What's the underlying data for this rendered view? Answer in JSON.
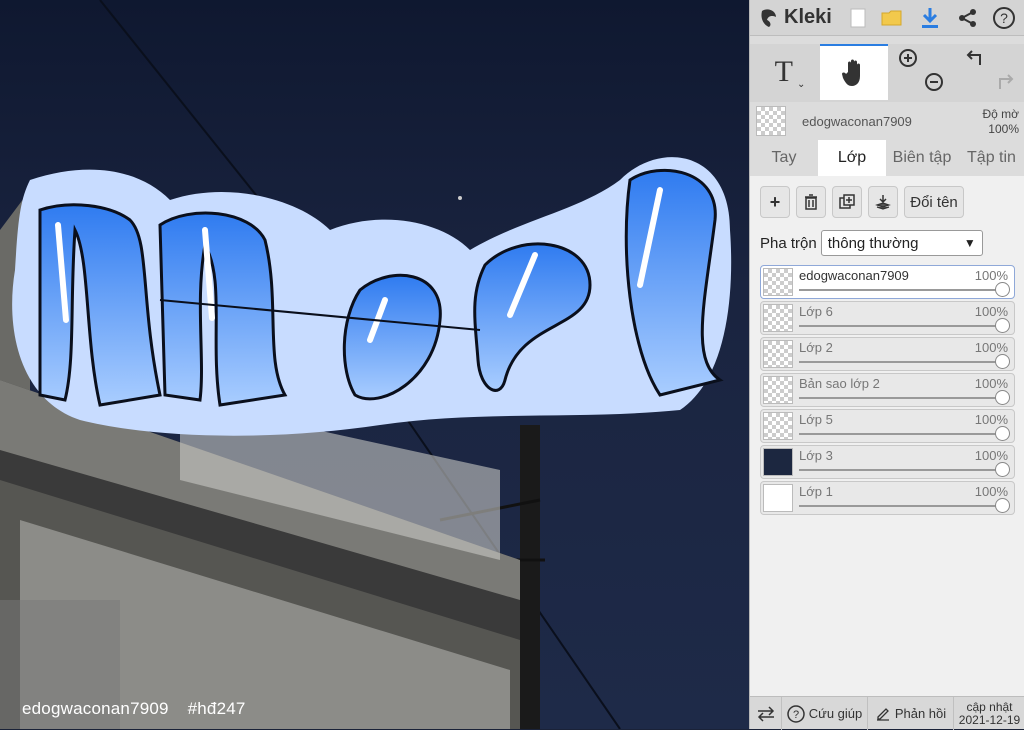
{
  "canvas": {
    "artwork_text": "Noel",
    "watermark": [
      "edogwaconan7909",
      "#hđ247"
    ]
  },
  "app": {
    "name": "Kleki"
  },
  "toolbar_icons": [
    "new-file-icon",
    "open-folder-icon",
    "download-icon",
    "share-icon",
    "help-icon"
  ],
  "tools": [
    "text-tool-icon",
    "hand-tool-icon",
    "zoom-in-icon",
    "zoom-out-icon",
    "undo-icon",
    "redo-icon"
  ],
  "layer_header": {
    "name": "edogwaconan7909",
    "opacity_label": "Độ mờ",
    "opacity_value": "100%"
  },
  "tabs": [
    {
      "label": "Tay",
      "active": false
    },
    {
      "label": "Lớp",
      "active": true
    },
    {
      "label": "Biên tập",
      "active": false
    },
    {
      "label": "Tập tin",
      "active": false
    }
  ],
  "layer_buttons": {
    "rename": "Đổi tên"
  },
  "blend": {
    "label": "Pha trộn",
    "value": "thông thường"
  },
  "layers": [
    {
      "name": "edogwaconan7909",
      "opacity": "100%",
      "selected": true
    },
    {
      "name": "Lớp 6",
      "opacity": "100%",
      "selected": false
    },
    {
      "name": "Lớp 2",
      "opacity": "100%",
      "selected": false
    },
    {
      "name": "Bản sao lớp 2",
      "opacity": "100%",
      "selected": false
    },
    {
      "name": "Lớp 5",
      "opacity": "100%",
      "selected": false
    },
    {
      "name": "Lớp 3",
      "opacity": "100%",
      "selected": false
    },
    {
      "name": "Lớp 1",
      "opacity": "100%",
      "selected": false
    }
  ],
  "bottom": {
    "help": "Cứu giúp",
    "feedback": "Phản hồi",
    "update_label": "cập nhật",
    "update_date": "2021-12-19"
  },
  "colors": {
    "accent": "#2a7de1",
    "sticker_outline": "#c8dcff",
    "letter_top": "#2f7bf0",
    "letter_bottom": "#a9cdff"
  }
}
